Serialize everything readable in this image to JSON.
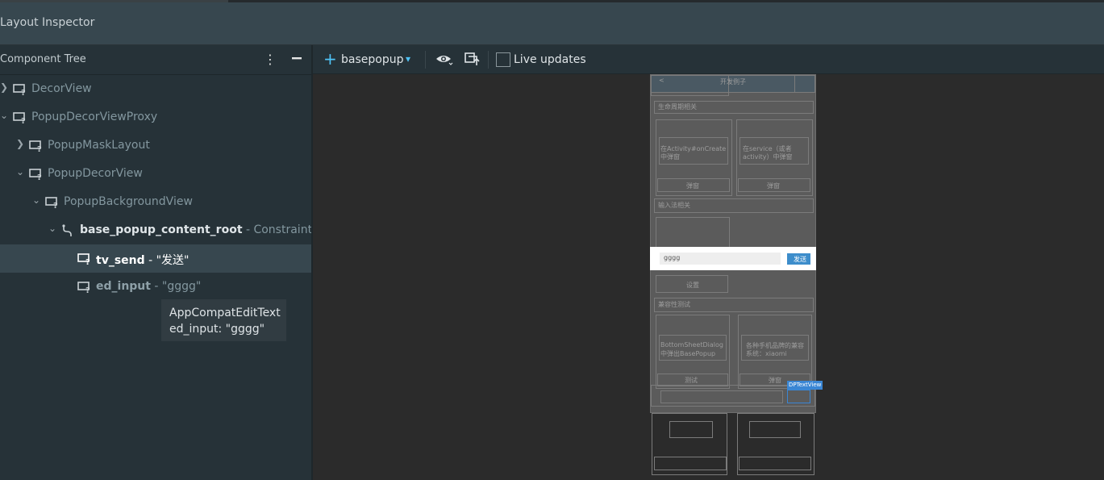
{
  "window": {
    "title": "Layout Inspector"
  },
  "component_tree": {
    "header": "Component Tree",
    "header_icons": [
      "more-vert-icon",
      "minimize-icon"
    ],
    "nodes": [
      {
        "name": "DecorView",
        "expanded": false
      },
      {
        "name": "PopupDecorViewProxy",
        "expanded": true
      },
      {
        "name": "PopupMaskLayout",
        "expanded": false
      },
      {
        "name": "PopupDecorView",
        "expanded": true
      },
      {
        "name": "PopupBackgroundView",
        "expanded": true
      },
      {
        "name": "base_popup_content_root",
        "suffix": " - ConstraintLa...",
        "expanded": true
      },
      {
        "name": "tv_send",
        "suffix": " - \"发送\"",
        "selected": true
      },
      {
        "name": "ed_input",
        "suffix": " - \"gggg\""
      }
    ],
    "tooltip": {
      "line1": "AppCompatEditText",
      "line2": "ed_input: \"gggg\""
    }
  },
  "toolbar": {
    "process": "basepopup",
    "live_updates_label": "Live updates",
    "live_updates_checked": false
  },
  "device": {
    "screen_title": "开发例子",
    "section1": "生命周期相关",
    "card1_text_a": "在Activity#onCreate",
    "card1_text_b": "中弹窗",
    "card2_text_a": "在service（或者",
    "card2_text_b": "activity）中弹窗",
    "btn_open": "弹窗",
    "section2": "输入法相关",
    "btn_settings": "设置",
    "popup_input_value": "gggg",
    "popup_send_label": "发送",
    "section3": "兼容性测试",
    "card3_text_a": "BottomSheetDialog",
    "card3_text_b": "中弹出BasePopup",
    "card4_text_a": "各种手机品牌的兼容",
    "card4_text_b": "系统：xiaomi",
    "btn_test": "测试",
    "dp_label": "DPTextView"
  }
}
